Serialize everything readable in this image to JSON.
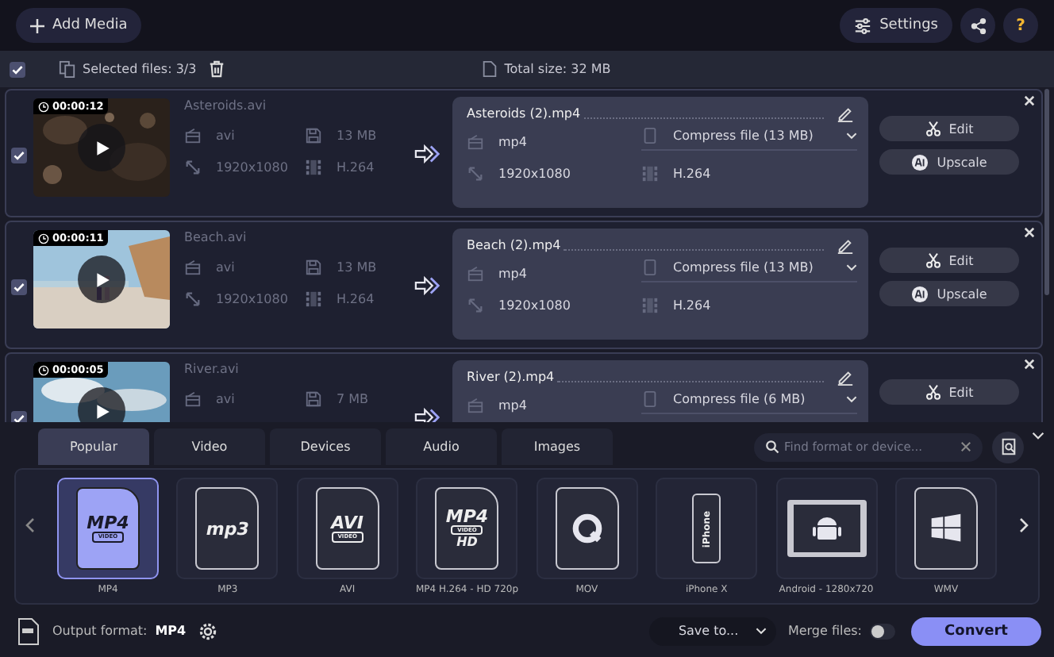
{
  "toolbar": {
    "add_media": "Add Media",
    "settings": "Settings",
    "help": "?"
  },
  "selection": {
    "checked": true,
    "selected_files": "Selected files: 3/3",
    "total_size": "Total size: 32 MB"
  },
  "files": [
    {
      "checked": true,
      "duration": "00:00:12",
      "source": {
        "name": "Asteroids.avi",
        "format": "avi",
        "size": "13 MB",
        "resolution": "1920x1080",
        "codec": "H.264"
      },
      "output": {
        "name": "Asteroids (2).mp4",
        "format": "mp4",
        "compress": "Compress file (13 MB)",
        "resolution": "1920x1080",
        "codec": "H.264"
      },
      "edit": "Edit",
      "upscale": "Upscale"
    },
    {
      "checked": true,
      "duration": "00:00:11",
      "source": {
        "name": "Beach.avi",
        "format": "avi",
        "size": "13 MB",
        "resolution": "1920x1080",
        "codec": "H.264"
      },
      "output": {
        "name": "Beach (2).mp4",
        "format": "mp4",
        "compress": "Compress file (13 MB)",
        "resolution": "1920x1080",
        "codec": "H.264"
      },
      "edit": "Edit",
      "upscale": "Upscale"
    },
    {
      "checked": true,
      "duration": "00:00:05",
      "source": {
        "name": "River.avi",
        "format": "avi",
        "size": "7 MB"
      },
      "output": {
        "name": "River (2).mp4",
        "format": "mp4",
        "compress": "Compress file (6 MB)"
      },
      "edit": "Edit"
    }
  ],
  "tabs": [
    {
      "label": "Popular",
      "selected": true
    },
    {
      "label": "Video",
      "selected": false
    },
    {
      "label": "Devices",
      "selected": false
    },
    {
      "label": "Audio",
      "selected": false
    },
    {
      "label": "Images",
      "selected": false
    }
  ],
  "search": {
    "placeholder": "Find format or device..."
  },
  "formats": [
    {
      "label": "MP4",
      "selected": true,
      "kind": "doc",
      "icon_text": "MP4",
      "icon_sub": "VIDEO"
    },
    {
      "label": "MP3",
      "selected": false,
      "kind": "doc",
      "icon_text": "mp3"
    },
    {
      "label": "AVI",
      "selected": false,
      "kind": "doc",
      "icon_text": "AVI",
      "icon_sub": "VIDEO"
    },
    {
      "label": "MP4 H.264 - HD 720p",
      "selected": false,
      "kind": "doc",
      "icon_text": "MP4",
      "icon_sub": "VIDEO",
      "icon_extra": "HD"
    },
    {
      "label": "MOV",
      "selected": false,
      "kind": "quicktime"
    },
    {
      "label": "iPhone X",
      "selected": false,
      "kind": "phone",
      "icon_text": "iPhone"
    },
    {
      "label": "Android - 1280x720",
      "selected": false,
      "kind": "tablet"
    },
    {
      "label": "WMV",
      "selected": false,
      "kind": "windows"
    }
  ],
  "output_format": {
    "label": "Output format:",
    "value": "MP4"
  },
  "save_to": "Save to...",
  "merge": {
    "label": "Merge files:",
    "on": false
  },
  "convert": "Convert"
}
